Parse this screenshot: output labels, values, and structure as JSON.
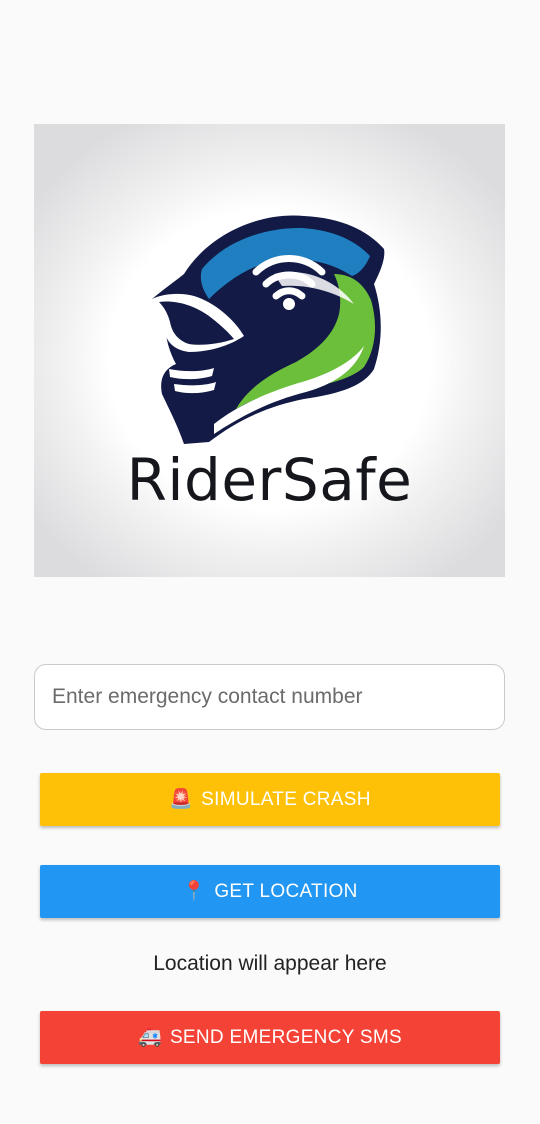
{
  "app": {
    "brand_name": "RiderSafe"
  },
  "contact": {
    "placeholder": "Enter emergency contact number",
    "value": ""
  },
  "buttons": {
    "simulate_crash": {
      "icon": "🚨",
      "icon_name": "siren-icon",
      "label": "SIMULATE CRASH",
      "color": "#ffc107"
    },
    "get_location": {
      "icon": "📍",
      "icon_name": "location-pin-icon",
      "label": "GET LOCATION",
      "color": "#2196f3"
    },
    "send_sms": {
      "icon": "🚑",
      "icon_name": "ambulance-icon",
      "label": "SEND EMERGENCY SMS",
      "color": "#f44336"
    }
  },
  "location": {
    "text": "Location will appear here"
  },
  "logo": {
    "icon_name": "helmet-wifi-logo",
    "colors": {
      "navy": "#121a45",
      "blue": "#1f7fc0",
      "green": "#6cbf3a",
      "white": "#ffffff"
    }
  }
}
